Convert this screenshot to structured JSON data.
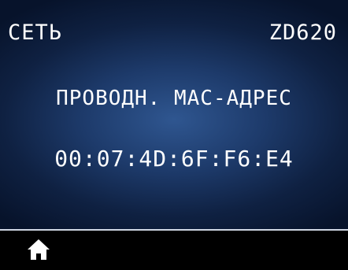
{
  "header": {
    "menu_title": "СЕТЬ",
    "model": "ZD620"
  },
  "setting": {
    "label": "ПРОВОДН. MAC-АДРЕС",
    "value": "00:07:4D:6F:F6:E4"
  },
  "footer": {
    "home_icon": "home-icon"
  },
  "colors": {
    "text": "#ffffff",
    "display_center": "#2f5690",
    "display_edge": "#07132b",
    "divider": "#cfd6e2",
    "footer_bg": "#000000"
  }
}
